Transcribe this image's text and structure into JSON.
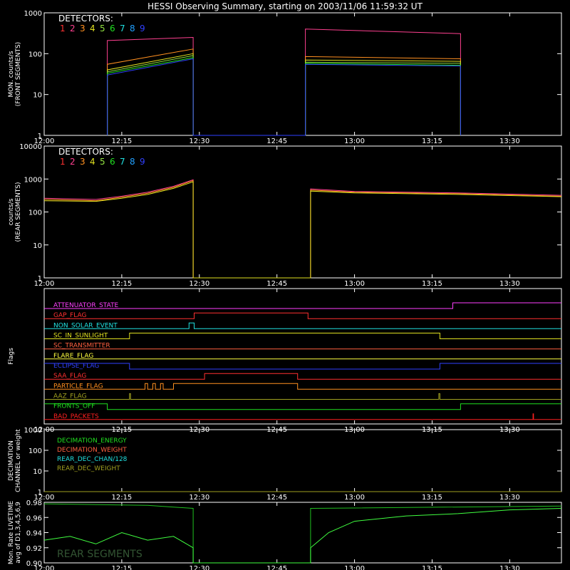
{
  "title": "HESSI Observing Summary, starting on 2003/11/06 11:59:32 UT",
  "time_ticks": [
    "12:00",
    "12:15",
    "12:30",
    "12:45",
    "13:00",
    "13:15",
    "13:30"
  ],
  "detector_colors": [
    "#ff3030",
    "#ff4090",
    "#ff9020",
    "#e0e020",
    "#90e040",
    "#20e020",
    "#20e0e0",
    "#20a0ff",
    "#3040ff"
  ],
  "chart_data": [
    {
      "type": "line",
      "panel": "front",
      "ylabel": [
        "MON. counts/s",
        "(FRONT SEGMENTS)"
      ],
      "y_scale": "log",
      "ylim": [
        1,
        1000
      ],
      "ytick_labels": [
        "1",
        "10",
        "100",
        "1000"
      ],
      "legend_title": "DETECTORS:",
      "legend_entries": [
        "1",
        "2",
        "3",
        "4",
        "5",
        "6",
        "7",
        "8",
        "9"
      ],
      "x_range": [
        "12:00",
        "13:40"
      ],
      "series": [
        {
          "values": [
            [
              12.2,
              1
            ],
            [
              12.2,
              210
            ],
            [
              28.8,
              250
            ],
            [
              28.8,
              1
            ],
            [
              50.5,
              1
            ],
            [
              50.5,
              400
            ],
            [
              80.5,
              310
            ],
            [
              80.5,
              1
            ]
          ]
        },
        {
          "values": [
            [
              12.2,
              1
            ],
            [
              12.2,
              55
            ],
            [
              28.8,
              130
            ],
            [
              28.8,
              1
            ],
            [
              50.5,
              1
            ],
            [
              50.5,
              85
            ],
            [
              80.5,
              75
            ],
            [
              80.5,
              1
            ]
          ]
        },
        {
          "values": [
            [
              12.2,
              1
            ],
            [
              12.2,
              40
            ],
            [
              28.8,
              100
            ],
            [
              28.8,
              1
            ],
            [
              50.5,
              1
            ],
            [
              50.5,
              70
            ],
            [
              80.5,
              65
            ],
            [
              80.5,
              1
            ]
          ]
        },
        {
          "values": [
            [
              12.2,
              1
            ],
            [
              12.2,
              36
            ],
            [
              28.8,
              90
            ],
            [
              28.8,
              1
            ],
            [
              50.5,
              1
            ],
            [
              50.5,
              62
            ],
            [
              80.5,
              58
            ],
            [
              80.5,
              1
            ]
          ]
        },
        {
          "values": [
            [
              12.2,
              1
            ],
            [
              12.2,
              33
            ],
            [
              28.8,
              80
            ],
            [
              28.8,
              1
            ],
            [
              50.5,
              1
            ],
            [
              50.5,
              58
            ],
            [
              80.5,
              52
            ],
            [
              80.5,
              1
            ]
          ]
        },
        {
          "values": [
            [
              12.2,
              1
            ],
            [
              12.2,
              30
            ],
            [
              28.8,
              75
            ],
            [
              28.8,
              1
            ],
            [
              50.5,
              1
            ],
            [
              50.5,
              55
            ],
            [
              80.5,
              50
            ],
            [
              80.5,
              1
            ]
          ]
        }
      ]
    },
    {
      "type": "line",
      "panel": "rear",
      "ylabel": [
        "counts/s",
        "(REAR SEGMENTS)"
      ],
      "y_scale": "log",
      "ylim": [
        1,
        10000
      ],
      "ytick_labels": [
        "1",
        "10",
        "100",
        "1000",
        "10000"
      ],
      "legend_title": "DETECTORS:",
      "legend_entries": [
        "1",
        "2",
        "3",
        "4",
        "5",
        "6",
        "7",
        "8",
        "9"
      ],
      "x_range": [
        "12:00",
        "13:40"
      ],
      "series": [
        {
          "values": [
            [
              0,
              260
            ],
            [
              10,
              240
            ],
            [
              15,
              300
            ],
            [
              20,
              400
            ],
            [
              25,
              600
            ],
            [
              28.8,
              950
            ],
            [
              28.8,
              1
            ],
            [
              51.5,
              1
            ],
            [
              51.5,
              500
            ],
            [
              60,
              420
            ],
            [
              80,
              380
            ],
            [
              100,
              320
            ]
          ]
        },
        {
          "values": [
            [
              0,
              240
            ],
            [
              10,
              220
            ],
            [
              15,
              280
            ],
            [
              20,
              370
            ],
            [
              25,
              560
            ],
            [
              28.8,
              900
            ],
            [
              28.8,
              1
            ],
            [
              51.5,
              1
            ],
            [
              51.5,
              460
            ],
            [
              60,
              400
            ],
            [
              80,
              360
            ],
            [
              100,
              300
            ]
          ]
        },
        {
          "values": [
            [
              0,
              220
            ],
            [
              10,
              210
            ],
            [
              15,
              260
            ],
            [
              20,
              340
            ],
            [
              25,
              520
            ],
            [
              28.8,
              820
            ],
            [
              28.8,
              1
            ],
            [
              51.5,
              1
            ],
            [
              51.5,
              430
            ],
            [
              60,
              380
            ],
            [
              80,
              340
            ],
            [
              100,
              290
            ]
          ]
        }
      ]
    },
    {
      "type": "line",
      "panel": "flags",
      "ylabel": [
        "Flags"
      ],
      "x_range": [
        "12:00",
        "13:40"
      ],
      "flags": [
        {
          "name": "ATTENUATOR_STATE",
          "color": "#ff40ff",
          "segments": [
            [
              0,
              0
            ],
            [
              79,
              0
            ],
            [
              79,
              1
            ],
            [
              100,
              1
            ]
          ]
        },
        {
          "name": "GAP_FLAG",
          "color": "#ff3030",
          "segments": [
            [
              0,
              0
            ],
            [
              29,
              0
            ],
            [
              29,
              1
            ],
            [
              51,
              1
            ],
            [
              51,
              0
            ],
            [
              100,
              0
            ]
          ]
        },
        {
          "name": "NON_SOLAR_EVENT",
          "color": "#20e0e0",
          "segments": [
            [
              0,
              0
            ],
            [
              28,
              0
            ],
            [
              28,
              1
            ],
            [
              29,
              1
            ],
            [
              29,
              0
            ],
            [
              100,
              0
            ]
          ]
        },
        {
          "name": "SC_IN_SUNLIGHT",
          "color": "#e0e020",
          "segments": [
            [
              0,
              0
            ],
            [
              16.5,
              0
            ],
            [
              16.5,
              1
            ],
            [
              76.5,
              1
            ],
            [
              76.5,
              0
            ],
            [
              100,
              0
            ]
          ]
        },
        {
          "name": "SC_TRANSMITTER",
          "color": "#ff6040",
          "segments": [
            [
              0,
              0
            ],
            [
              100,
              0
            ]
          ]
        },
        {
          "name": "FLARE_FLAG",
          "color": "#ffff40",
          "segments": [
            [
              0,
              0
            ],
            [
              100,
              0
            ]
          ]
        },
        {
          "name": "ECLIPSE_FLAG",
          "color": "#3040ff",
          "segments": [
            [
              0,
              1
            ],
            [
              16.5,
              1
            ],
            [
              16.5,
              0
            ],
            [
              76.5,
              0
            ],
            [
              76.5,
              1
            ],
            [
              100,
              1
            ]
          ]
        },
        {
          "name": "SAA_FLAG",
          "color": "#ff3030",
          "segments": [
            [
              0,
              0
            ],
            [
              31,
              0
            ],
            [
              31,
              1
            ],
            [
              49,
              1
            ],
            [
              49,
              0
            ],
            [
              100,
              0
            ]
          ]
        },
        {
          "name": "PARTICLE_FLAG",
          "color": "#ff9020",
          "segments": [
            [
              0,
              0
            ],
            [
              19.5,
              0
            ],
            [
              19.5,
              1
            ],
            [
              20,
              1
            ],
            [
              20,
              0
            ],
            [
              21,
              0
            ],
            [
              21,
              1
            ],
            [
              21.5,
              1
            ],
            [
              21.5,
              0
            ],
            [
              22.5,
              0
            ],
            [
              22.5,
              1
            ],
            [
              23,
              1
            ],
            [
              23,
              0
            ],
            [
              25,
              0
            ],
            [
              25,
              1
            ],
            [
              49,
              1
            ],
            [
              49,
              0
            ],
            [
              100,
              0
            ]
          ]
        },
        {
          "name": "AAZ_FLAG",
          "color": "#a0a020",
          "segments": [
            [
              0,
              0
            ],
            [
              16.5,
              0
            ],
            [
              16.5,
              1
            ],
            [
              16.7,
              1
            ],
            [
              16.7,
              0
            ],
            [
              76.3,
              0
            ],
            [
              76.3,
              1
            ],
            [
              76.5,
              1
            ],
            [
              76.5,
              0
            ],
            [
              100,
              0
            ]
          ]
        },
        {
          "name": "FRONTS_OFF",
          "color": "#20e020",
          "segments": [
            [
              0,
              1
            ],
            [
              12.2,
              1
            ],
            [
              12.2,
              0
            ],
            [
              80.5,
              0
            ],
            [
              80.5,
              1
            ],
            [
              100,
              1
            ]
          ]
        },
        {
          "name": "BAD_PACKETS",
          "color": "#ff2020",
          "segments": [
            [
              0,
              0
            ],
            [
              94.5,
              0
            ],
            [
              94.5,
              1
            ],
            [
              94.6,
              1
            ],
            [
              94.6,
              0
            ],
            [
              100,
              0
            ]
          ]
        }
      ]
    },
    {
      "type": "line",
      "panel": "decimation",
      "ylabel": [
        "DECIMATION",
        "CHANNEL or weight"
      ],
      "y_scale": "log",
      "ylim": [
        1,
        1000
      ],
      "ytick_labels": [
        "1",
        "10",
        "100",
        "1000"
      ],
      "x_range": [
        "12:00",
        "13:40"
      ],
      "legend_entries": [
        {
          "name": "DECIMATION_ENERGY",
          "color": "#20e020"
        },
        {
          "name": "DECIMATION_WEIGHT",
          "color": "#ff6040"
        },
        {
          "name": "REAR_DEC_CHAN/128",
          "color": "#20e0e0"
        },
        {
          "name": "REAR_DEC_WEIGHT",
          "color": "#a0a020"
        }
      ],
      "series": [
        {
          "values": [
            [
              0,
              1
            ],
            [
              100,
              1
            ]
          ]
        }
      ]
    },
    {
      "type": "line",
      "panel": "livetime",
      "ylabel": [
        "Mon. Rate LIVETIME",
        "avg of D1,3,4,5,6,9"
      ],
      "ylim": [
        0.9,
        0.98
      ],
      "ytick_labels": [
        "0.90",
        "0.92",
        "0.94",
        "0.96",
        "0.98"
      ],
      "x_range": [
        "12:00",
        "13:40"
      ],
      "background_text": "REAR SEGMENTS",
      "series": [
        {
          "values": [
            [
              0,
              0.978
            ],
            [
              10,
              0.977
            ],
            [
              20,
              0.976
            ],
            [
              28.8,
              0.972
            ],
            [
              28.8,
              0.9
            ],
            [
              51.5,
              0.9
            ],
            [
              51.5,
              0.972
            ],
            [
              100,
              0.975
            ]
          ]
        },
        {
          "values": [
            [
              0,
              0.93
            ],
            [
              5,
              0.935
            ],
            [
              10,
              0.925
            ],
            [
              15,
              0.94
            ],
            [
              20,
              0.93
            ],
            [
              25,
              0.935
            ],
            [
              28.8,
              0.92
            ],
            [
              28.8,
              0.9
            ],
            [
              51.5,
              0.9
            ],
            [
              51.5,
              0.92
            ],
            [
              55,
              0.94
            ],
            [
              60,
              0.955
            ],
            [
              70,
              0.962
            ],
            [
              80,
              0.965
            ],
            [
              90,
              0.97
            ],
            [
              100,
              0.972
            ]
          ]
        }
      ]
    }
  ]
}
